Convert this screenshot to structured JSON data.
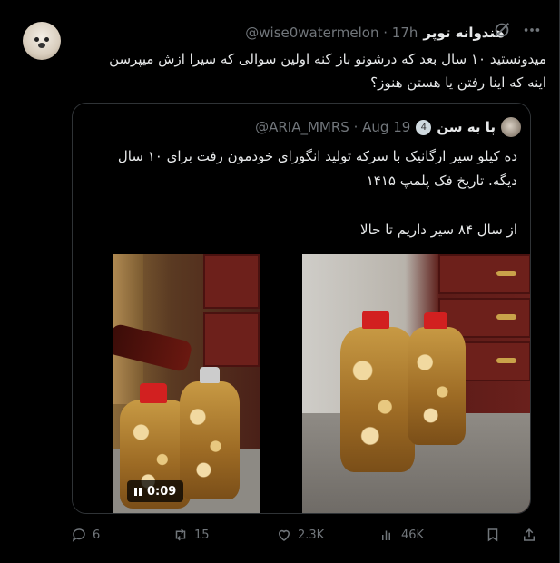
{
  "tweet": {
    "display_name": "هندوانه توپر",
    "handle": "@wise0watermelon",
    "time": "17h",
    "text_lines": [
      "میدونستید ۱۰ سال بعد که درشونو باز کنه اولین سوالی که سیرا ازش میپرسن",
      "اینه که اینا رفتن یا هستن هنوز؟"
    ]
  },
  "quote": {
    "display_name": "پا به سن",
    "badge": "4",
    "handle": "@ARIA_MMRS",
    "time": "Aug 19",
    "text_lines": [
      "ده کیلو سیر ارگانیک با سرکه تولید انگورای خودمون رفت برای ۱۰ سال",
      "دیگه. تاریخ فک پلمپ ۱۴۱۵",
      "",
      "از سال ۸۴ سیر داریم تا حالا"
    ],
    "video_time": "0:09"
  },
  "actions": {
    "replies": "6",
    "reposts": "15",
    "likes": "2.3K",
    "views": "46K"
  },
  "icons": [
    "grok-icon",
    "more-icon",
    "reply-icon",
    "repost-icon",
    "like-icon",
    "views-icon",
    "bookmark-icon",
    "share-icon",
    "pause-icon"
  ],
  "colors": {
    "background": "#000000",
    "text": "#e7e9ea",
    "muted": "#71767b",
    "border": "#2f3336"
  }
}
